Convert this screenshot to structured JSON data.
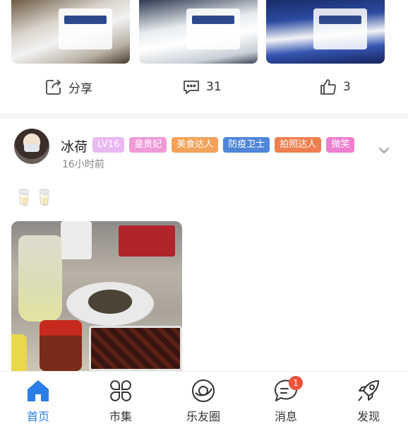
{
  "feed": {
    "prev_post_actions": {
      "share_label": "分享",
      "comment_count": "31",
      "like_count": "3"
    },
    "post": {
      "username": "冰荷",
      "badges": [
        {
          "label": "LV16",
          "color": "#e9b9f2"
        },
        {
          "label": "皇贵妃",
          "color": "#f09ad8"
        },
        {
          "label": "美食达人",
          "color": "#f3a25a"
        },
        {
          "label": "防疫卫士",
          "color": "#4f86d8"
        },
        {
          "label": "拍照达人",
          "color": "#ef7f4f"
        },
        {
          "label": "微笑",
          "color": "#ef7fd0"
        }
      ],
      "timestamp": "16小时前",
      "caption": "🥛🥛"
    }
  },
  "tabbar": {
    "home": "首页",
    "market": "市集",
    "circle": "乐友圈",
    "messages": "消息",
    "messages_badge": "1",
    "discover": "发现",
    "active": "home"
  },
  "colors": {
    "accent": "#2b7de9",
    "notification": "#f0513a"
  }
}
